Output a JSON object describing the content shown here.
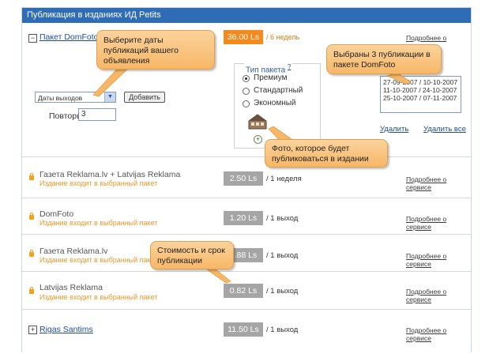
{
  "header": {
    "title": "Публикация в изданиях ИД Petits"
  },
  "common": {
    "service_link": "Подробнее о сервисе"
  },
  "package": {
    "name": "Пакет DomFoto",
    "toggle": "−",
    "price": "36.00 Ls",
    "duration": "/ 6 недель",
    "dates_select": "Даты выходов",
    "add_button": "Добавить",
    "repeats_label": "Повторы:",
    "repeats_value": "3",
    "selected_dates": [
      "27-09-2007 / 10-10-2007",
      "11-10-2007 / 24-10-2007",
      "25-10-2007 / 07-11-2007"
    ],
    "delete_link": "Удалить",
    "delete_all_link": "Удалить все",
    "type_title": "Тип пакета",
    "type_help": "?",
    "types": [
      {
        "label": "Премиум",
        "selected": true
      },
      {
        "label": "Стандартный",
        "selected": false
      },
      {
        "label": "Экономный",
        "selected": false
      }
    ],
    "photo_add": "+"
  },
  "publications": [
    {
      "name": "Газета Reklama.lv + Latvijas Reklama",
      "note": "Издание входит в выбранный пакет",
      "price": "2.50 Ls",
      "duration": "/ 1 неделя"
    },
    {
      "name": "DomFoto",
      "note": "Издание входит в выбранный пакет",
      "price": "1.20 Ls",
      "duration": "/ 1 выход"
    },
    {
      "name": "Газета Reklama.lv",
      "note": "Издание входит в выбранный пакет",
      "price": "0.88 Ls",
      "duration": "/ 1 выход"
    },
    {
      "name": "Latvijas Reklama",
      "note": "Издание входит в выбранный пакет",
      "price": "0.82 Ls",
      "duration": "/ 1 выход"
    }
  ],
  "rigas": {
    "name": "Rigas Santims",
    "toggle": "+",
    "price": "11.50 Ls",
    "duration": "/ 1 выход"
  },
  "callouts": {
    "dates": "Выберите даты публикаций вашего объявления",
    "selected": "Выбраны 3  публикации в пакете DomFoto",
    "photo": "Фото, которое будет публиковаться в издании",
    "price": "Стоимость и срок публикации"
  },
  "colors": {
    "header_bg": "#2e6db5",
    "active_price": "#f58a1c",
    "inactive_price": "#a5a5a5",
    "callout": "#f7b767",
    "note": "#e89a2a"
  }
}
